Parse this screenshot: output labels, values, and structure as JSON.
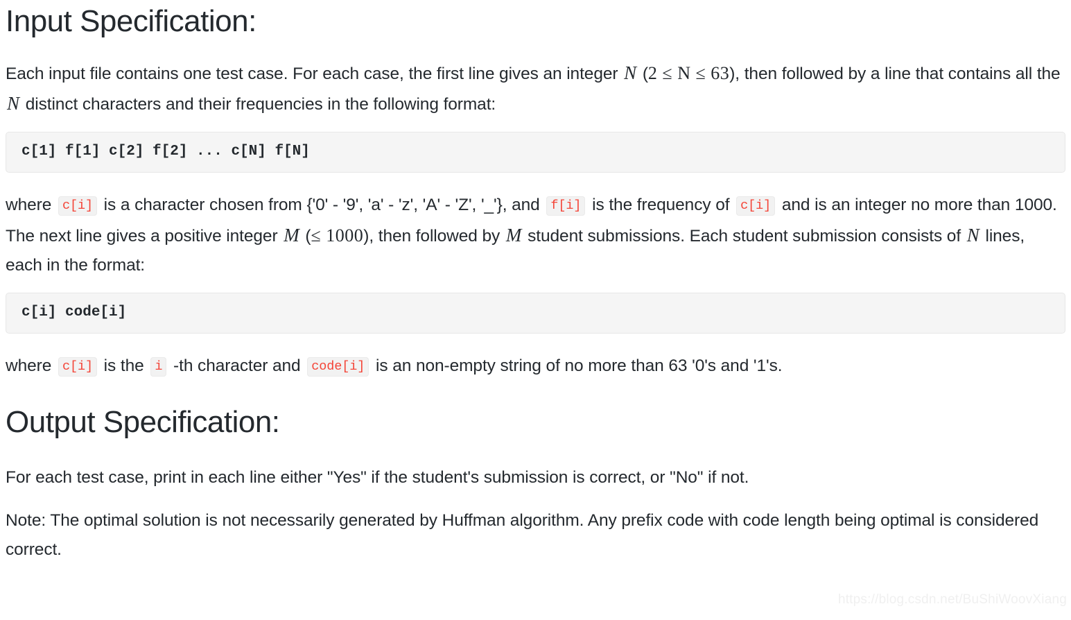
{
  "sections": {
    "input": {
      "heading": "Input Specification:",
      "para1": {
        "t1": "Each input file contains one test case. For each case, the first line gives an integer ",
        "math_N": "N",
        "t2": " (",
        "math_range": "2 ≤ N ≤ 63",
        "t3": "), then followed by a line that contains all the ",
        "math_N2": "N",
        "t4": " distinct characters and their frequencies in the following format:"
      },
      "code1": "c[1] f[1] c[2] f[2] ... c[N] f[N]",
      "para2": {
        "t1": "where ",
        "code_ci_1": "c[i]",
        "t2": " is a character chosen from {'0' - '9', 'a' - 'z', 'A' - 'Z', '_'}, and ",
        "code_fi": "f[i]",
        "t3": " is the frequency of ",
        "code_ci_2": "c[i]",
        "t4": " and is an integer no more than 1000. The next line gives a positive integer ",
        "math_M": "M",
        "t5": " (",
        "math_M_range": "≤ 1000",
        "t6": "), then followed by ",
        "math_M2": "M",
        "t7": " student submissions. Each student submission consists of ",
        "math_N3": "N",
        "t8": " lines, each in the format:"
      },
      "code2": "c[i] code[i]",
      "para3": {
        "t1": "where ",
        "code_ci": "c[i]",
        "t2": " is the ",
        "code_i": "i",
        "t3": " -th character and ",
        "code_codei": "code[i]",
        "t4": " is an non-empty string of no more than 63 '0's and '1's."
      }
    },
    "output": {
      "heading": "Output Specification:",
      "para1": "For each test case, print in each line either \"Yes\" if the student's submission is correct, or \"No\" if not.",
      "para2": "Note: The optimal solution is not necessarily generated by Huffman algorithm. Any prefix code with code length being optimal is considered correct."
    }
  },
  "watermark": "https://blog.csdn.net/BuShiWoovXiang",
  "colors": {
    "text": "#24292e",
    "inline_code": "#f44336",
    "code_bg": "#f5f5f5",
    "code_border": "#e7e7e7",
    "watermark": "#f0f0f0"
  }
}
